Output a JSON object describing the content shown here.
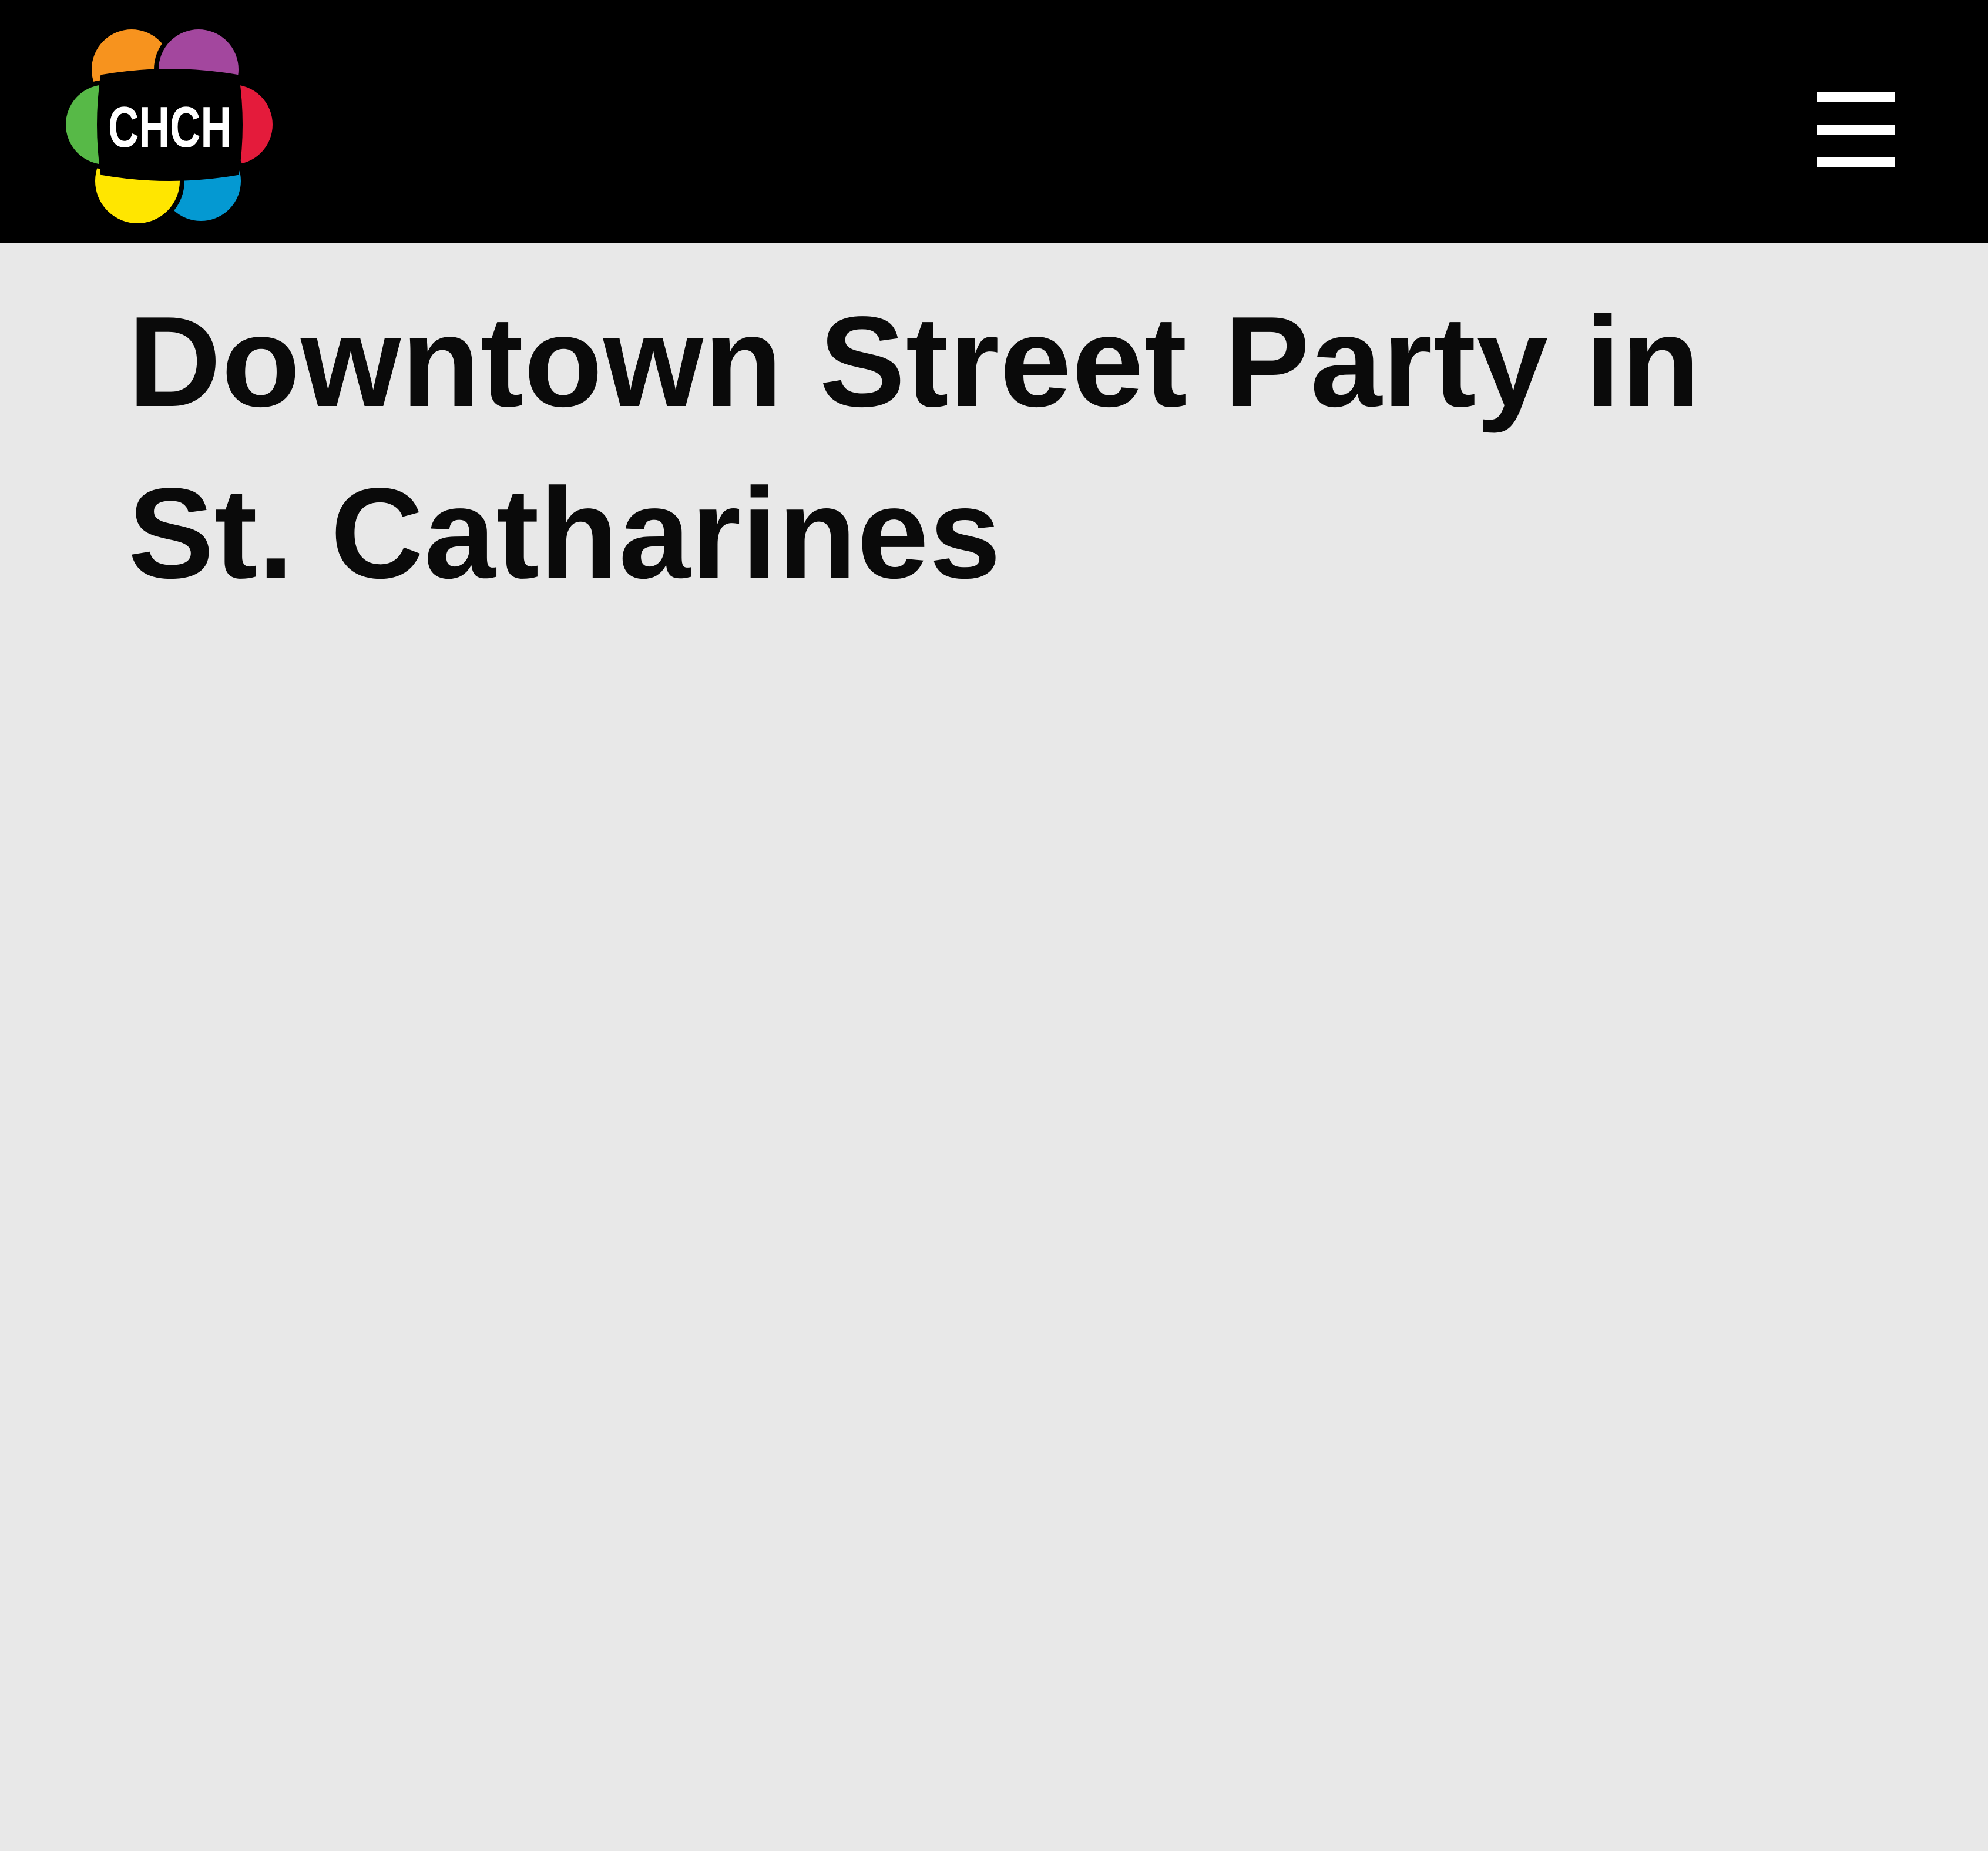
{
  "header": {
    "logo_text": "CHCH",
    "logo_colors": {
      "orange": "#f7931e",
      "purple": "#a3479e",
      "red": "#e41b3b",
      "blue": "#0499d2",
      "yellow": "#ffe600",
      "green": "#57b947"
    },
    "menu_icon": "hamburger-icon"
  },
  "article": {
    "title": "Downtown Street Party in St. Catharines"
  },
  "colors": {
    "header_background": "#000000",
    "page_background": "#e8e8e8",
    "title_text": "#0a0a0a"
  }
}
